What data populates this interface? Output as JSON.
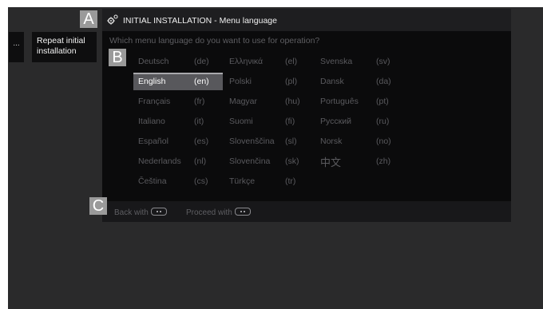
{
  "sidebar": {
    "more_label": "...",
    "item_label": "Repeat initial installation"
  },
  "dialog": {
    "title": "INITIAL INSTALLATION - Menu language",
    "title_icon": "gear-icon",
    "question": "Which menu language do you want to use for operation?",
    "languages": [
      {
        "name": "Deutsch",
        "code": "(de)"
      },
      {
        "name": "English",
        "code": "(en)",
        "selected": true
      },
      {
        "name": "Français",
        "code": "(fr)"
      },
      {
        "name": "Italiano",
        "code": "(it)"
      },
      {
        "name": "Español",
        "code": "(es)"
      },
      {
        "name": "Nederlands",
        "code": "(nl)"
      },
      {
        "name": "Čeština",
        "code": "(cs)"
      },
      {
        "name": "Ελληνικά",
        "code": "(el)"
      },
      {
        "name": "Polski",
        "code": "(pl)"
      },
      {
        "name": "Magyar",
        "code": "(hu)"
      },
      {
        "name": "Suomi",
        "code": "(fi)"
      },
      {
        "name": "Slovenščina",
        "code": "(sl)"
      },
      {
        "name": "Slovenčina",
        "code": "(sk)"
      },
      {
        "name": "Türkçe",
        "code": "(tr)"
      },
      {
        "name": "Svenska",
        "code": "(sv)"
      },
      {
        "name": "Dansk",
        "code": "(da)"
      },
      {
        "name": "Português",
        "code": "(pt)"
      },
      {
        "name": "Русский",
        "code": "(ru)"
      },
      {
        "name": "Norsk",
        "code": "(no)"
      },
      {
        "name": "中文",
        "code": "(zh)"
      }
    ],
    "footer": {
      "back_label": "Back with",
      "proceed_label": "Proceed with",
      "key_icon": "remote-key-icon"
    }
  },
  "callouts": {
    "a": "A",
    "b": "B",
    "c": "C"
  },
  "colors": {
    "screen_background": "#2a2a2b",
    "dialog_background": "#0b0b0c",
    "selected_background": "#58585c",
    "inactive_text": "#5a5a5e",
    "callout_background": "#9a9a9a"
  }
}
